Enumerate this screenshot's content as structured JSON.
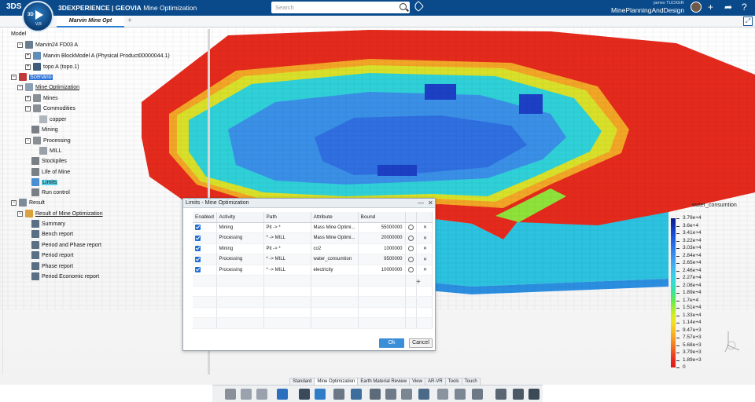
{
  "topbar": {
    "brand_logo": "3DS",
    "compass_3d": "3D",
    "compass_version": "V,R",
    "title_brand": "3DEXPERIENCE | GEOVIA",
    "title_app": "Mine Optimization",
    "search_placeholder": "Search",
    "user_name": "james TUCKER",
    "platform": "MinePlanningAndDesign",
    "icons": [
      "tag-icon",
      "avatar",
      "plus-icon",
      "share-icon",
      "help-icon"
    ]
  },
  "tabs": {
    "active": "Marvin Mine Opt",
    "add_label": "+"
  },
  "tree": {
    "model": "Model",
    "marvin_fd": "Marvin24 FD03 A",
    "blockmodel": "Marvin BlockModel A (Physical Product00000044.1)",
    "topo": "topo A (topo.1)",
    "scenario": "Scenario",
    "mine_opt": "Mine Optimization",
    "mines": "Mines",
    "commodities": "Commodities",
    "copper": "copper",
    "mining": "Mining",
    "processing": "Processing",
    "mill": "MILL",
    "stockpiles": "Stockpiles",
    "life_of_mine": "Life of Mine",
    "limits": "Limits",
    "run_control": "Run control",
    "result": "Result",
    "result_mine_opt": "Result of Mine Optimization",
    "summary": "Summary",
    "bench": "Bench report",
    "period_phase": "Period and Phase report",
    "period": "Period report",
    "phase": "Phase report",
    "period_econ": "Period Economic report"
  },
  "legend": {
    "title": "water_consumtion",
    "labels": [
      "3.79e+4",
      "3.6e+4",
      "3.41e+4",
      "3.22e+4",
      "3.03e+4",
      "2.84e+4",
      "2.65e+4",
      "2.46e+4",
      "2.27e+4",
      "2.08e+4",
      "1.89e+4",
      "1.7e+4",
      "1.51e+4",
      "1.33e+4",
      "1.14e+4",
      "9.47e+3",
      "7.57e+3",
      "5.68e+3",
      "3.79e+3",
      "1.89e+3",
      "0"
    ],
    "colors": [
      "#0a1a8a",
      "#1030b0",
      "#1848d0",
      "#2060e0",
      "#2c78ea",
      "#3890ee",
      "#40a8f0",
      "#40c0ee",
      "#38d4e0",
      "#30e0c8",
      "#38e690",
      "#60ea50",
      "#9aee30",
      "#d4ee20",
      "#f4e020",
      "#f8c020",
      "#f8a020",
      "#f47c20",
      "#ee5020",
      "#e82820",
      "#e01818"
    ]
  },
  "dialog": {
    "title": "Limits - Mine Optimization",
    "columns": [
      "Enabled",
      "Activity",
      "Path",
      "Attribute",
      "Bound"
    ],
    "rows": [
      {
        "activity": "Mining",
        "path": "Pit -> *",
        "attribute": "Mass Mine Optimi...",
        "bound": "55000000"
      },
      {
        "activity": "Processing",
        "path": "* -> MILL",
        "attribute": "Mass Mine Optimi...",
        "bound": "20000000"
      },
      {
        "activity": "Mining",
        "path": "Pit -> *",
        "attribute": "co2",
        "bound": "1000000"
      },
      {
        "activity": "Processing",
        "path": "* -> MILL",
        "attribute": "water_consumtion",
        "bound": "9500000"
      },
      {
        "activity": "Processing",
        "path": "* -> MILL",
        "attribute": "electricity",
        "bound": "10000000"
      }
    ],
    "add_label": "+",
    "ok_label": "Ok",
    "cancel_label": "Cancel",
    "minimize": "—",
    "close": "✕"
  },
  "workbench_tabs": [
    "Standard",
    "Mine Optimization",
    "Earth Material Review",
    "View",
    "AR-VR",
    "Tools",
    "Touch"
  ],
  "workbench_active": "Mine Optimization"
}
